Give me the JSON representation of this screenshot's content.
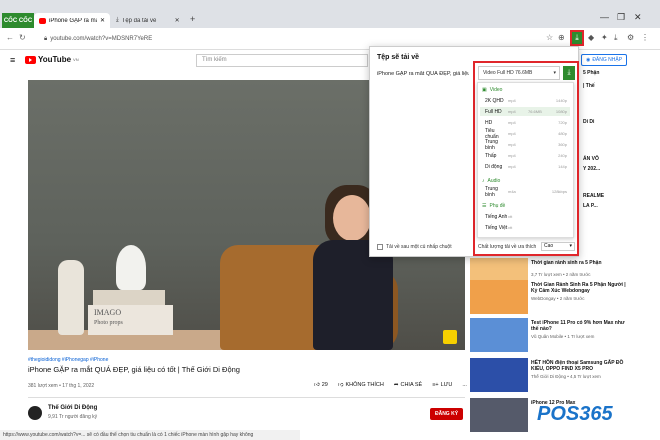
{
  "browser": {
    "brand": "CỐC CỐC",
    "tabs": [
      {
        "label": "iPhone GẶP ra mắt QUÁ ĐẸP",
        "active": true
      },
      {
        "label": "Tệp đã tải về",
        "active": false
      }
    ],
    "new_tab": "+",
    "url": "youtube.com/watch?v=MDSNR7YeRE",
    "window_controls": [
      "—",
      "❐",
      "✕"
    ]
  },
  "youtube": {
    "logo": "YouTube",
    "logo_sup": "VN",
    "search_placeholder": "Tìm kiếm",
    "signin_label": "ĐĂNG NHẬP"
  },
  "video": {
    "book_top": "IMAGO",
    "book_bottom": "Photo props",
    "tags": "#thegioididong #iPhonegap #iPhone",
    "title": "iPhone GẶP ra mắt QUÁ ĐẸP, giá liệu có tốt | Thế Giới Di Động",
    "views": "381 lượt xem • 17 thg 1, 2022",
    "likes": "29",
    "dislike_label": "KHÔNG THÍCH",
    "share_label": "CHIA SẺ",
    "save_label": "LƯU",
    "more_label": "...",
    "channel": "Thế Giới Di Động",
    "subscribers": "9,91 Tr người đăng ký",
    "subscribe_label": "ĐĂNG KÝ",
    "status_url": "https://www.youtube.com/watch?v=... sẽ có đầu thể chọn tiu chuẩn là có 1 chiếc iPhone màn hình gập hay không"
  },
  "download_popup": {
    "title": "Tệp sẽ tải về",
    "file_name": "iPhone GẶP ra mắt QUÁ ĐẸP, giá liệu có tốt | Th...",
    "selected": "Video Full HD 76.6MB",
    "sections": {
      "video": "Video",
      "audio": "Audio",
      "subs": "Phụ đề"
    },
    "video_rows": [
      {
        "q": "2K QHD",
        "fmt": "mp4",
        "sz": "",
        "res": "1440p"
      },
      {
        "q": "Full HD",
        "fmt": "mp4",
        "sz": "76.6MB",
        "res": "1080p"
      },
      {
        "q": "HD",
        "fmt": "mp4",
        "sz": "",
        "res": "720p"
      },
      {
        "q": "Tiêu chuẩn",
        "fmt": "mp4",
        "sz": "",
        "res": "480p"
      },
      {
        "q": "Trung bình",
        "fmt": "mp4",
        "sz": "",
        "res": "360p"
      },
      {
        "q": "Thấp",
        "fmt": "mp4",
        "sz": "",
        "res": "240p"
      },
      {
        "q": "Di động",
        "fmt": "mp4",
        "sz": "",
        "res": "144p"
      }
    ],
    "audio_rows": [
      {
        "q": "Trung bình",
        "fmt": "m4a",
        "sz": "",
        "res": "128kbps"
      }
    ],
    "sub_rows": [
      {
        "q": "Tiếng Anh",
        "fmt": "vtt",
        "sz": "",
        "res": ""
      },
      {
        "q": "Tiếng Việt",
        "fmt": "vtt",
        "sz": "",
        "res": ""
      }
    ],
    "auto_dl_label": "Tải về sau một cú nhấp chuột",
    "quality_label": "Chất lượng tải về ưa thích",
    "quality_value": "Cao"
  },
  "sidebar": {
    "right_items": [
      {
        "text": "5 Phận"
      },
      {
        "text": "| Thế"
      },
      {
        "text": "Di Di"
      },
      {
        "text": "ÁN VÔ"
      },
      {
        "text": "Y 202..."
      },
      {
        "text": "REALME"
      },
      {
        "text": "LA P..."
      }
    ],
    "items": [
      {
        "title": "Thời gian rảnh sinh ra 5 Phận",
        "meta": "3,7 Tr lượt xem • 2 năm trước",
        "color": "#f3c07a"
      },
      {
        "title": "Thời Gian Rảnh Sinh Ra 5 Phận Người | Kỷ Cảm Xúc Webdongay",
        "meta": "WebDongay • 2 năm trước",
        "color": "#f0a04a"
      },
      {
        "title": "Test iPhone 11 Pro có 9% hơn Max như thế nào?",
        "meta": "Vũ Quân Mobile • 1 Tr lượt xem",
        "color": "#5b8fd6"
      },
      {
        "title": "HẾT HỒN điện thoại Samsung GẤP ĐỒ KIỂU, OPPO FIND X5 PRO",
        "meta": "Thế Giới Di Động • 4,5 Tr lượt xem",
        "color": "#2c4fa8"
      },
      {
        "title": "iPhone 12 Pro Max",
        "meta": "",
        "color": "#555a6a"
      }
    ],
    "watermark_p": "P",
    "watermark_os": "OS",
    "watermark_num": "365"
  },
  "colors": {
    "accent_red": "#e0262b",
    "coccoc_green": "#2e8b2e",
    "youtube_red": "#ff0000"
  }
}
